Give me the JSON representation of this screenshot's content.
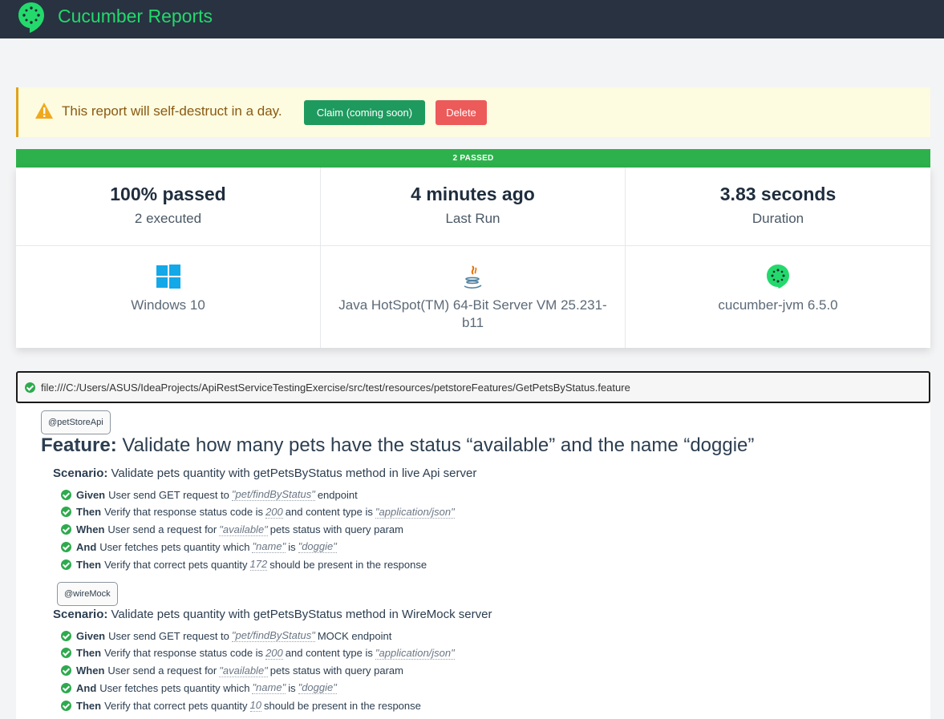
{
  "header": {
    "brand": "Cucumber Reports",
    "logo_icon": "cucumber-logo-icon",
    "colors": {
      "bar": "#293241",
      "brand": "#23d96c"
    }
  },
  "banner": {
    "icon": "warning-icon",
    "message": "This report will self-destruct in a day.",
    "claim_label": "Claim (coming soon)",
    "delete_label": "Delete"
  },
  "status_bar": {
    "label": "2 PASSED",
    "color": "#2db14c"
  },
  "summary": {
    "passed": {
      "value": "100% passed",
      "sub": "2 executed"
    },
    "last_run": {
      "value": "4 minutes ago",
      "sub": "Last Run"
    },
    "duration": {
      "value": "3.83 seconds",
      "sub": "Duration"
    },
    "os": {
      "icon": "windows-icon",
      "label": "Windows 10"
    },
    "jvm": {
      "icon": "java-icon",
      "label": "Java HotSpot(TM) 64-Bit Server VM 25.231-b11"
    },
    "runner": {
      "icon": "cucumber-icon",
      "label": "cucumber-jvm 6.5.0"
    }
  },
  "feature": {
    "file": "file:///C:/Users/ASUS/IdeaProjects/ApiRestServiceTestingExercise/src/test/resources/petstoreFeatures/GetPetsByStatus.feature",
    "tag": "@petStoreApi",
    "keyword": "Feature:",
    "title": "Validate how many pets have the status “available” and the name “doggie”",
    "scenarios": [
      {
        "tag": "",
        "keyword": "Scenario:",
        "title": "Validate pets quantity with getPetsByStatus method in live Api server",
        "steps": [
          {
            "kw": "Given",
            "parts": [
              "User send GET request to",
              "\"pet/findByStatus\"",
              "endpoint"
            ]
          },
          {
            "kw": "Then",
            "parts": [
              "Verify that response status code is",
              "200",
              "and content type is",
              "\"application/json\""
            ]
          },
          {
            "kw": "When",
            "parts": [
              "User send a request for",
              "\"available\"",
              "pets status with query param"
            ]
          },
          {
            "kw": "And",
            "parts": [
              "User fetches pets quantity which",
              "\"name\"",
              "is",
              "\"doggie\""
            ]
          },
          {
            "kw": "Then",
            "parts": [
              "Verify that correct pets quantity",
              "172",
              "should be present in the response"
            ]
          }
        ]
      },
      {
        "tag": "@wireMock",
        "keyword": "Scenario:",
        "title": "Validate pets quantity with getPetsByStatus method in WireMock server",
        "steps": [
          {
            "kw": "Given",
            "parts": [
              "User send GET request to",
              "\"pet/findByStatus\"",
              "MOCK endpoint"
            ]
          },
          {
            "kw": "Then",
            "parts": [
              "Verify that response status code is",
              "200",
              "and content type is",
              "\"application/json\""
            ]
          },
          {
            "kw": "When",
            "parts": [
              "User send a request for",
              "\"available\"",
              "pets status with query param"
            ]
          },
          {
            "kw": "And",
            "parts": [
              "User fetches pets quantity which",
              "\"name\"",
              "is",
              "\"doggie\""
            ]
          },
          {
            "kw": "Then",
            "parts": [
              "Verify that correct pets quantity",
              "10",
              "should be present in the response"
            ]
          }
        ]
      }
    ]
  }
}
